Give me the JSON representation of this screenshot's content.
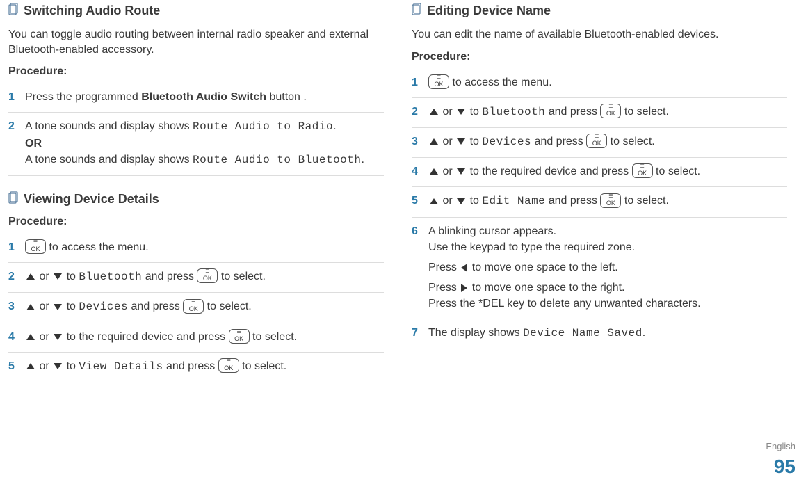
{
  "page_number": "95",
  "english_label": "English",
  "left": {
    "sec1": {
      "title": "Switching Audio Route",
      "intro": "You can toggle audio routing between internal radio speaker and external Bluetooth-enabled accessory.",
      "procedure_label": "Procedure:",
      "step1_pre": "Press the programmed ",
      "step1_bold": "Bluetooth Audio Switch",
      "step1_post": " button .",
      "step2_a": "A tone sounds and display shows ",
      "step2_a_mono": "Route Audio to Radio",
      "step2_or": "OR",
      "step2_b": "A tone sounds and display shows ",
      "step2_b_mono": "Route Audio to Bluetooth",
      "period": "."
    },
    "sec2": {
      "title": "Viewing Device Details",
      "procedure_label": "Procedure:",
      "s1_post": " to access the menu.",
      "s_or": " or ",
      "s_to": " to ",
      "to_select": " to select.",
      "and_press": " and press ",
      "bluetooth": "Bluetooth",
      "devices": "Devices",
      "req_device": " to the required device and press ",
      "view_details": "View Details"
    }
  },
  "right": {
    "sec1": {
      "title": "Editing Device Name",
      "intro": "You can edit the name of available Bluetooth-enabled devices.",
      "procedure_label": "Procedure:",
      "s1_post": " to access the menu.",
      "s_or": " or ",
      "s_to": " to ",
      "to_select": " to select.",
      "and_press": " and press ",
      "bluetooth": "Bluetooth",
      "devices": "Devices",
      "req_device": " to the required device and press ",
      "edit_name": "Edit Name",
      "s6_l1": "A blinking cursor appears.",
      "s6_l2": "Use the keypad to type the required zone.",
      "s6_l3a": "Press ",
      "s6_l3b": " to move one space to the left.",
      "s6_l4a": "Press ",
      "s6_l4b": " to move one space to the right.",
      "s6_l5": "Press the *DEL key to delete any unwanted characters.",
      "s7_a": "The display shows ",
      "s7_mono": "Device Name Saved",
      "period": "."
    }
  },
  "nums": {
    "n1": "1",
    "n2": "2",
    "n3": "3",
    "n4": "4",
    "n5": "5",
    "n6": "6",
    "n7": "7"
  },
  "ok_label": "OK"
}
